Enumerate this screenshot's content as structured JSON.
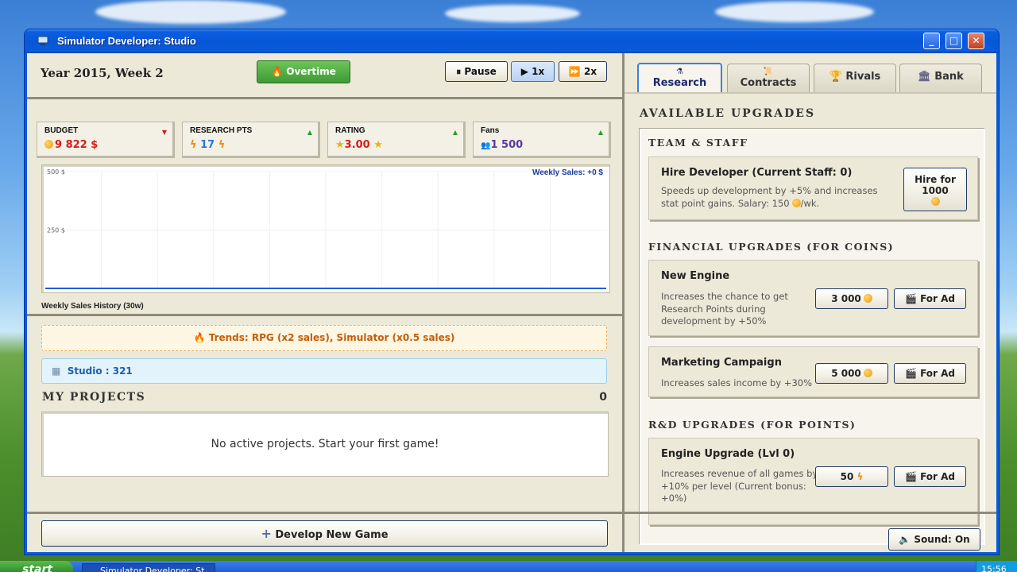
{
  "window": {
    "title": "Simulator Developer: Studio",
    "minimize": "_",
    "maximize": "□",
    "close": "✕"
  },
  "header": {
    "date": "Year 2015, Week 2",
    "overtime_label": "Overtime",
    "pause_label": "Pause",
    "speed1_label": "1x",
    "speed2_label": "2x"
  },
  "stats": [
    {
      "label": "BUDGET",
      "value": "9 822 $",
      "trend": "down",
      "color": "#d41c1c"
    },
    {
      "label": "RESEARCH PTS",
      "value": "17",
      "trend": "up",
      "color": "#2a74d8"
    },
    {
      "label": "RATING",
      "value": "3.00",
      "trend": "up",
      "color": "#d41c1c"
    },
    {
      "label": "Fans",
      "value": "1 500",
      "trend": "up",
      "color": "#5a3aa0"
    }
  ],
  "chart_data": {
    "type": "line",
    "title": "Weekly Sales: +0 $",
    "caption": "Weekly Sales History (30w)",
    "yticks": [
      "500 $",
      "250 $"
    ],
    "ylim": [
      0,
      500
    ],
    "series": [
      {
        "values": [
          0,
          0
        ]
      }
    ]
  },
  "trend_banner": "Trends: RPG (x2 sales), Simulator (x0.5 sales)",
  "studio_banner": "Studio : 321",
  "projects": {
    "title": "MY PROJECTS",
    "count": "0",
    "empty_text": "No active projects. Start your first game!"
  },
  "develop_button": "Develop New Game",
  "tabs": [
    "Research",
    "Contracts",
    "Rivals",
    "Bank"
  ],
  "upgrades": {
    "heading": "AVAILABLE UPGRADES",
    "team_section": "TEAM & STAFF",
    "hire": {
      "title": "Hire Developer (Current Staff: 0)",
      "desc1": "Speeds up development by +5% and increases",
      "desc2_a": "stat point gains. Salary: 150",
      "desc2_b": "/wk.",
      "btn_line1": "Hire for",
      "btn_line2": "1000"
    },
    "financial_section": "FINANCIAL UPGRADES (FOR COINS)",
    "engine": {
      "title": "New Engine",
      "desc1": "Increases the chance to get",
      "desc2": "Research Points during",
      "desc3": "development by +50%",
      "price": "3 000",
      "ad": "For Ad"
    },
    "marketing": {
      "title": "Marketing Campaign",
      "desc1": "Increases sales income by +30%",
      "price": "5 000",
      "ad": "For Ad"
    },
    "rd_section": "R&D UPGRADES (FOR POINTS)",
    "engine_upgrade": {
      "title": "Engine Upgrade (Lvl 0)",
      "desc1": "Increases revenue of all games by",
      "desc2": "+10% per level (Current bonus:",
      "desc3": "+0%)",
      "price": "50",
      "ad": "For Ad"
    }
  },
  "sound_button": "Sound: On",
  "taskbar": {
    "start": "start",
    "task": "Simulator Developer: St",
    "clock": "15:56"
  }
}
